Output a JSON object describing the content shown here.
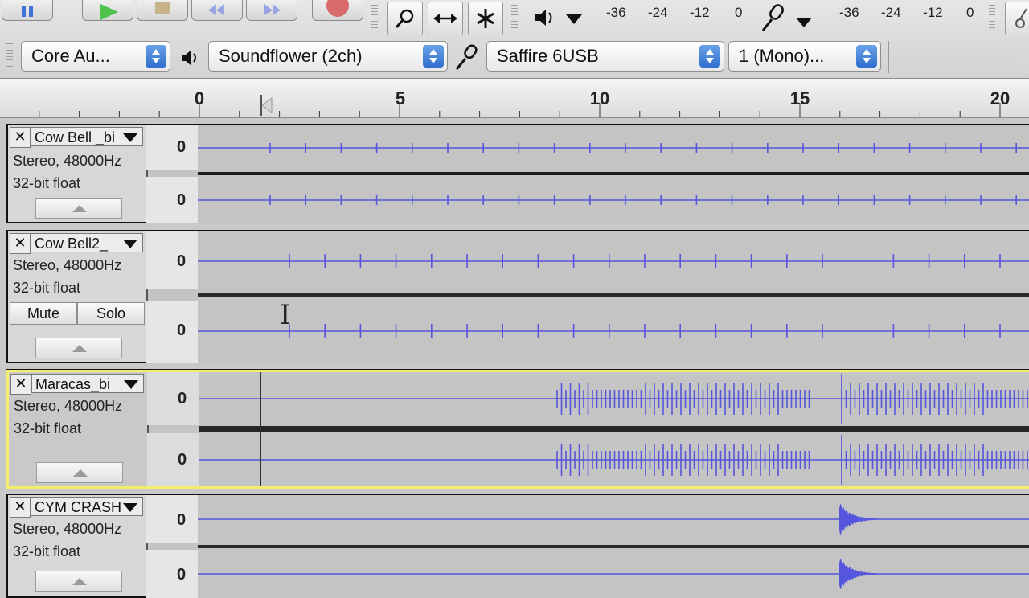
{
  "toolbar": {
    "play_icon": "play-icon",
    "stop_icon": "stop-icon",
    "skip_start_icon": "skip-start-icon",
    "skip_end_icon": "skip-end-icon",
    "record_icon": "record-icon",
    "tools": [
      "zoom-icon",
      "timeshift-icon",
      "multi-tool-icon"
    ],
    "playback_meter_labels": [
      "-36",
      "-24",
      "-12",
      "0"
    ],
    "record_meter_labels": [
      "-36",
      "-24",
      "-12",
      "0"
    ]
  },
  "device_bar": {
    "host": "Core Au...",
    "output_device": "Soundflower (2ch)",
    "input_device": "Saffire 6USB",
    "input_channels": "1 (Mono)..."
  },
  "ruler": {
    "labels": [
      "0",
      "5",
      "10",
      "15",
      "20"
    ]
  },
  "tracks": [
    {
      "name": "Cow Bell _bi",
      "format": "Stereo, 48000Hz",
      "bit_depth": "32-bit float",
      "channel_scale": [
        "0",
        "0"
      ],
      "selected": false
    },
    {
      "name": "Cow Bell2_",
      "format": "Stereo, 48000Hz",
      "bit_depth": "32-bit float",
      "mute_label": "Mute",
      "solo_label": "Solo",
      "channel_scale": [
        "0",
        "0"
      ],
      "selected": false
    },
    {
      "name": "Maracas_bi",
      "format": "Stereo, 48000Hz",
      "bit_depth": "32-bit float",
      "channel_scale": [
        "0",
        "0"
      ],
      "selected": true
    },
    {
      "name": "CYM CRASH",
      "format": "Stereo, 48000Hz",
      "bit_depth": "32-bit float",
      "channel_scale": [
        "0",
        "0"
      ],
      "selected": false
    }
  ],
  "colors": {
    "waveform": "#5555dd",
    "selected_border": "#f3ee6b"
  }
}
